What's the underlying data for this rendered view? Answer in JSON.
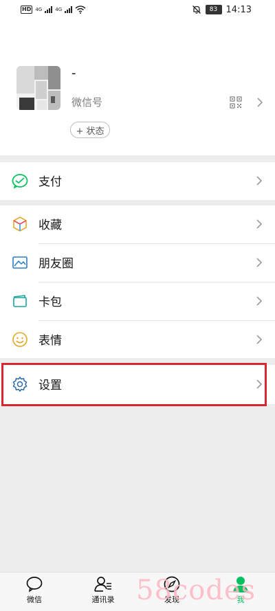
{
  "status_bar": {
    "hd_label": "HD",
    "net_1": "4G",
    "net_2": "4G",
    "battery": "83",
    "time": "14:13"
  },
  "profile": {
    "nickname": "-",
    "wechat_id": "微信号",
    "status_button": "+ 状态"
  },
  "menu": {
    "pay": "支付",
    "favorites": "收藏",
    "moments": "朋友圈",
    "cards": "卡包",
    "stickers": "表情",
    "settings": "设置"
  },
  "tabbar": {
    "chats": "微信",
    "contacts": "通讯录",
    "discover": "发现",
    "me": "我"
  },
  "watermark": "58codes",
  "colors": {
    "accent": "#07c160",
    "highlight": "#d9252f",
    "watermark": "#ffb6c1"
  }
}
